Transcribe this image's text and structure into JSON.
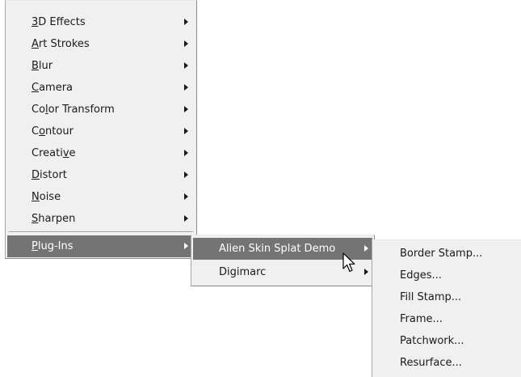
{
  "menu_main": {
    "items": [
      {
        "pre": "",
        "key": "3",
        "post": "D Effects"
      },
      {
        "pre": "",
        "key": "A",
        "post": "rt Strokes"
      },
      {
        "pre": "",
        "key": "B",
        "post": "lur"
      },
      {
        "pre": "",
        "key": "C",
        "post": "amera"
      },
      {
        "pre": "Co",
        "key": "l",
        "post": "or Transform"
      },
      {
        "pre": "C",
        "key": "o",
        "post": "ntour"
      },
      {
        "pre": "Creati",
        "key": "v",
        "post": "e"
      },
      {
        "pre": "",
        "key": "D",
        "post": "istort"
      },
      {
        "pre": "",
        "key": "N",
        "post": "oise"
      },
      {
        "pre": "",
        "key": "S",
        "post": "harpen"
      }
    ],
    "plugins": {
      "pre": "",
      "key": "P",
      "post": "lug-Ins"
    }
  },
  "menu_plugins": {
    "items": [
      "Alien Skin Splat Demo",
      "Digimarc"
    ]
  },
  "menu_splat": {
    "items": [
      "Border Stamp...",
      "Edges...",
      "Fill Stamp...",
      "Frame...",
      "Patchwork...",
      "Resurface..."
    ]
  },
  "icons": {
    "submenu": "submenu-arrow-icon",
    "cursor": "mouse-pointer-icon"
  },
  "colors": {
    "menu_bg": "#f0f0f0",
    "highlight": "#747474"
  }
}
